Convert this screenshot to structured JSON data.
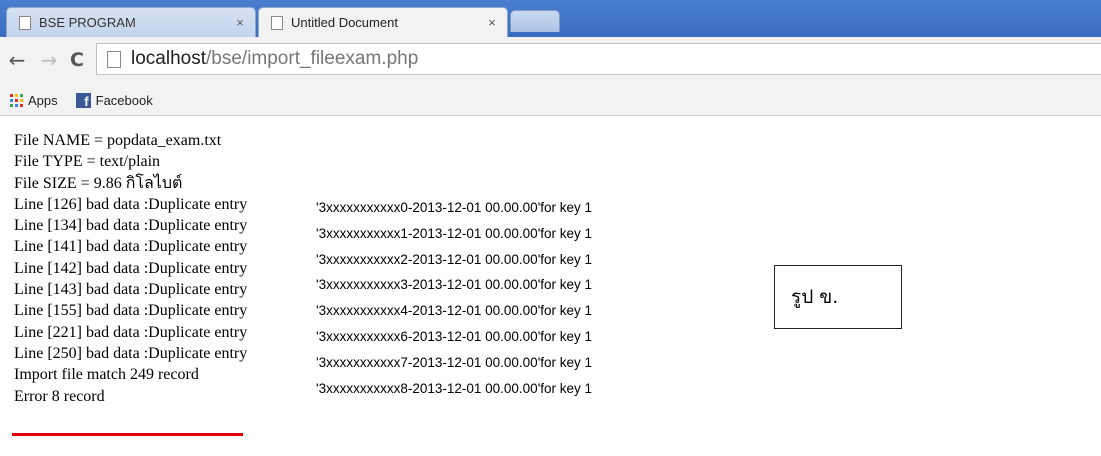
{
  "browser": {
    "tabs": [
      {
        "title": "BSE PROGRAM",
        "close": "×"
      },
      {
        "title": "Untitled Document",
        "close": "×"
      }
    ],
    "address": {
      "host": "localhost",
      "path": "/bse/import_fileexam.php"
    },
    "bookmarks": [
      {
        "label": "Apps",
        "icon": "apps-grid-icon"
      },
      {
        "label": "Facebook",
        "icon": "facebook-icon"
      }
    ],
    "icons": {
      "back": "←",
      "forward": "→",
      "reload": "C"
    }
  },
  "content": {
    "log_lines": [
      "File NAME = popdata_exam.txt",
      "File TYPE = text/plain",
      "File SIZE = 9.86 กิโลไบต์",
      "Line [126] bad data :Duplicate entry",
      "Line [134] bad data :Duplicate entry",
      "Line [141] bad data :Duplicate entry",
      "Line [142] bad data :Duplicate entry",
      "Line [143] bad data :Duplicate entry",
      "Line [155] bad data :Duplicate entry",
      "Line [221] bad data :Duplicate entry",
      "Line [250] bad data :Duplicate entry",
      "Import file match 249 record",
      "Error 8 record"
    ],
    "duplicate_keys": [
      "'3xxxxxxxxxxx0-2013-12-01 00.00.00'for key 1",
      "'3xxxxxxxxxxx1-2013-12-01 00.00.00'for key 1",
      "'3xxxxxxxxxxx2-2013-12-01 00.00.00'for key 1",
      "'3xxxxxxxxxxx3-2013-12-01 00.00.00'for key 1",
      "'3xxxxxxxxxxx4-2013-12-01 00.00.00'for key 1",
      "'3xxxxxxxxxxx6-2013-12-01 00.00.00'for key 1",
      "'3xxxxxxxxxxx7-2013-12-01 00.00.00'for key 1",
      "'3xxxxxxxxxxx8-2013-12-01 00.00.00'for key 1"
    ],
    "figure_label": "รูป ข."
  },
  "colors": {
    "underline": "#e00000",
    "tabbar": "#3a6cc0",
    "facebook": "#3b5998"
  }
}
